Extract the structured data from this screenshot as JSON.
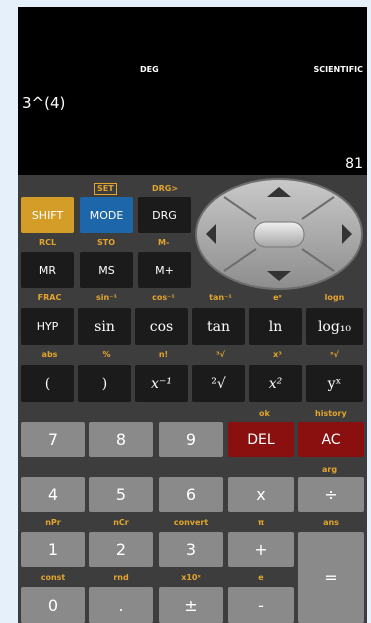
{
  "display": {
    "angle_mode": "DEG",
    "calc_mode": "SCIENTIFIC",
    "expression": "3^(4)",
    "result": "81"
  },
  "row_top_labels": {
    "set": "SET",
    "drg_arrow": "DRG>"
  },
  "row_top": {
    "shift": "SHIFT",
    "mode": "MODE",
    "drg": "DRG"
  },
  "row_mem_labels": {
    "rcl": "RCL",
    "sto": "STO",
    "m_minus": "M-"
  },
  "row_mem": {
    "mr": "MR",
    "ms": "MS",
    "m_plus": "M+"
  },
  "row_fn1_labels": [
    "FRAC",
    "sin⁻¹",
    "cos⁻¹",
    "tan⁻¹",
    "eˣ",
    "logn"
  ],
  "row_fn1": [
    "HYP",
    "sin",
    "cos",
    "tan",
    "ln",
    "log₁₀"
  ],
  "row_fn2_labels": [
    "abs",
    "%",
    "n!",
    "³√",
    "x³",
    "ˣ√"
  ],
  "row_fn2": [
    "(",
    ")",
    "x⁻¹",
    "²√",
    "x²",
    "yˣ"
  ],
  "row_7_labels": {
    "ok": "ok",
    "history": "history"
  },
  "row_7": [
    "7",
    "8",
    "9",
    "DEL",
    "AC"
  ],
  "row_4_labels": {
    "arg": "arg"
  },
  "row_4": [
    "4",
    "5",
    "6",
    "x",
    "÷"
  ],
  "row_1_labels": [
    "nPr",
    "nCr",
    "convert",
    "π",
    "ans"
  ],
  "row_1": [
    "1",
    "2",
    "3",
    "+",
    "="
  ],
  "row_0_labels": [
    "const",
    "rnd",
    "x10ˣ",
    "e"
  ],
  "row_0": [
    "0",
    ".",
    "±",
    "-"
  ]
}
